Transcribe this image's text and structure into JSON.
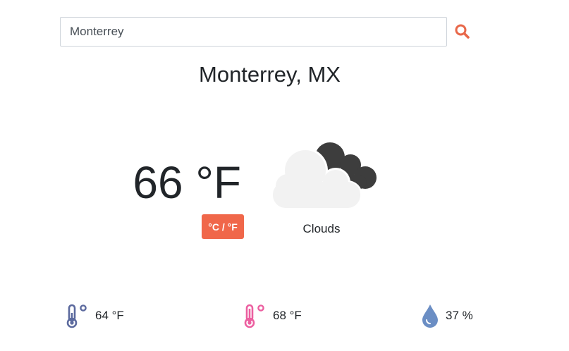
{
  "search": {
    "value": "Monterrey",
    "placeholder": "",
    "icon": "search-icon"
  },
  "location": {
    "label": "Monterrey, MX"
  },
  "current": {
    "temperature": "66 °F",
    "condition": "Clouds",
    "icon": "partly-cloudy-icon"
  },
  "unit_toggle": {
    "label": "°C / °F"
  },
  "stats": {
    "min_temp": {
      "value": "64 °F",
      "icon": "thermometer-low-icon"
    },
    "max_temp": {
      "value": "68 °F",
      "icon": "thermometer-high-icon"
    },
    "humidity": {
      "value": "37 %",
      "icon": "humidity-drop-icon"
    }
  },
  "colors": {
    "accent": "#f0674a",
    "search_icon": "#e8684a",
    "thermo_low": "#5c6a9e",
    "thermo_high": "#ec5fa0",
    "humidity": "#6b8ec4",
    "cloud_light": "#f2f2f2",
    "cloud_dark": "#3d3d3d"
  }
}
